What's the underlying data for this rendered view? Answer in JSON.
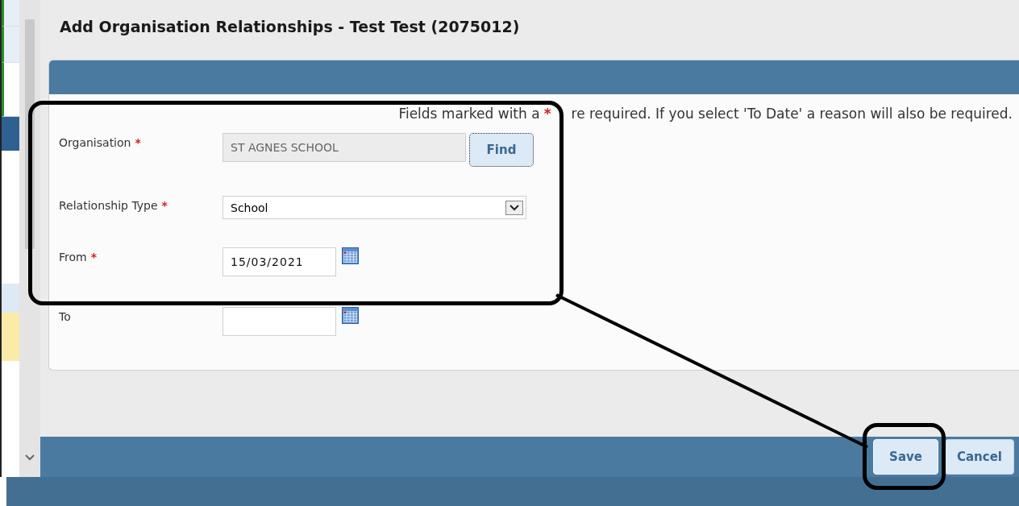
{
  "sidebar_tabs": [
    {
      "selected": false
    },
    {
      "selected": false
    },
    {
      "selected": true
    }
  ],
  "dialog": {
    "title": "Add Organisation Relationships - Test Test (2075012)"
  },
  "note": {
    "before": "Fields marked with a",
    "marker": "*",
    "after": "re required. If you select 'To Date' a reason will also be required."
  },
  "fields": [
    {
      "kind": "lookup",
      "label": "Organisation",
      "marker": "*",
      "value": "ST AGNES SCHOOL",
      "disabled": true,
      "button": "Find"
    },
    {
      "kind": "select",
      "label": "Relationship Type",
      "marker": "*",
      "value": "School"
    },
    {
      "kind": "date",
      "label": "From",
      "marker": "*",
      "value": "15/03/2021"
    },
    {
      "kind": "date",
      "label": "To"
    }
  ],
  "buttons": [
    {
      "label": "Save",
      "highlighted": true
    },
    {
      "label": "Cancel",
      "highlighted": false
    }
  ]
}
